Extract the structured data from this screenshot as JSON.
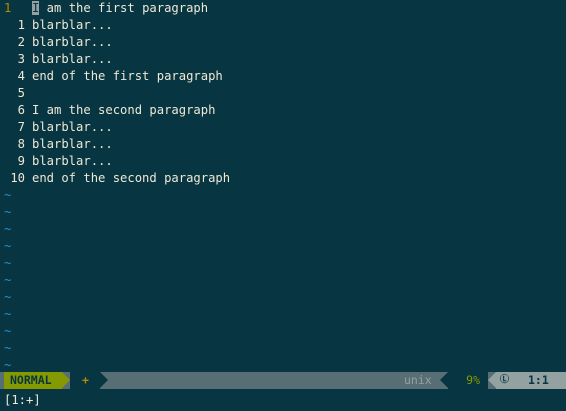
{
  "buffer": {
    "lines": [
      {
        "num": "1",
        "text": "I am the first paragraph",
        "current": true
      },
      {
        "num": "1",
        "text": "blarblar..."
      },
      {
        "num": "2",
        "text": "blarblar..."
      },
      {
        "num": "3",
        "text": "blarblar..."
      },
      {
        "num": "4",
        "text": "end of the first paragraph"
      },
      {
        "num": "5",
        "text": ""
      },
      {
        "num": "6",
        "text": "I am the second paragraph"
      },
      {
        "num": "7",
        "text": "blarblar..."
      },
      {
        "num": "8",
        "text": "blarblar..."
      },
      {
        "num": "9",
        "text": "blarblar..."
      },
      {
        "num": "10",
        "text": "end of the second paragraph"
      }
    ],
    "empty_marker": "~",
    "empty_line_count": 11
  },
  "statusline": {
    "mode": "NORMAL",
    "modified": "+",
    "fileformat": "unix",
    "percent": "9%",
    "line_icon": "LN",
    "position": "1:1"
  },
  "cmdline": {
    "text": "[1:+]"
  },
  "colors": {
    "background": "#073642",
    "text": "#eee8d5",
    "line_number_current": "#b58900",
    "tilde": "#268bd2",
    "mode_bg": "#859900",
    "statusline_bg": "#586e75",
    "position_bg": "#93a1a1"
  }
}
